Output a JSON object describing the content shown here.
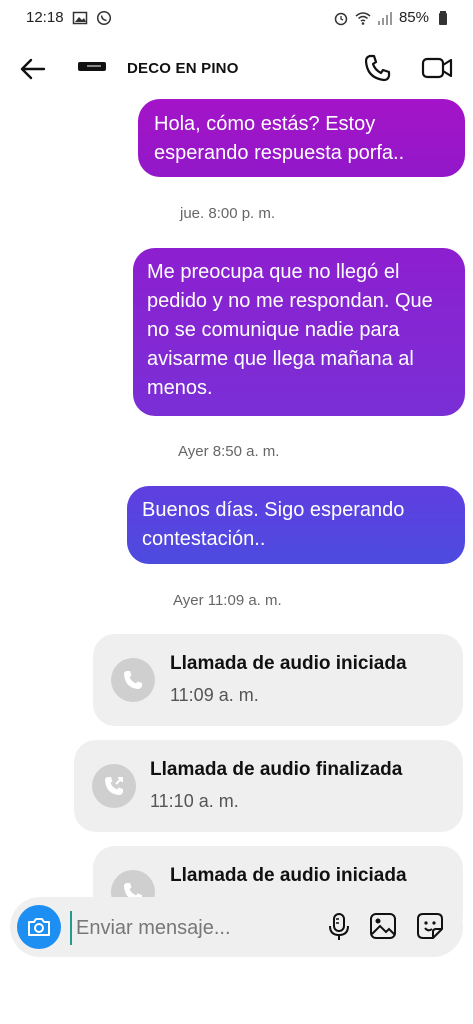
{
  "status_bar": {
    "time": "12:18",
    "battery": "85%"
  },
  "header": {
    "title": "DECO EN PINO"
  },
  "messages": [
    {
      "text": "Hola, cómo estás?  Estoy esperando respuesta porfa.."
    },
    {
      "timestamp": "jue. 8:00 p. m."
    },
    {
      "text": "Me preocupa que no llegó el pedido y no me respondan. Que no se comunique nadie para avisarme que llega mañana al menos."
    },
    {
      "timestamp": "Ayer 8:50 a. m."
    },
    {
      "text": "Buenos días. Sigo esperando contestación.."
    },
    {
      "timestamp": "Ayer 11:09 a. m."
    }
  ],
  "calls": [
    {
      "title": "Llamada de audio iniciada",
      "time": "11:09 a. m."
    },
    {
      "title": "Llamada de audio finalizada",
      "time": "11:10 a. m."
    },
    {
      "title": "Llamada de audio iniciada"
    }
  ],
  "composer": {
    "placeholder": "Enviar mensaje..."
  },
  "colors": {
    "accent": "#1d8ff2",
    "bubble_top": "#a414c8",
    "bubble_bottom": "#4d4bdf"
  }
}
